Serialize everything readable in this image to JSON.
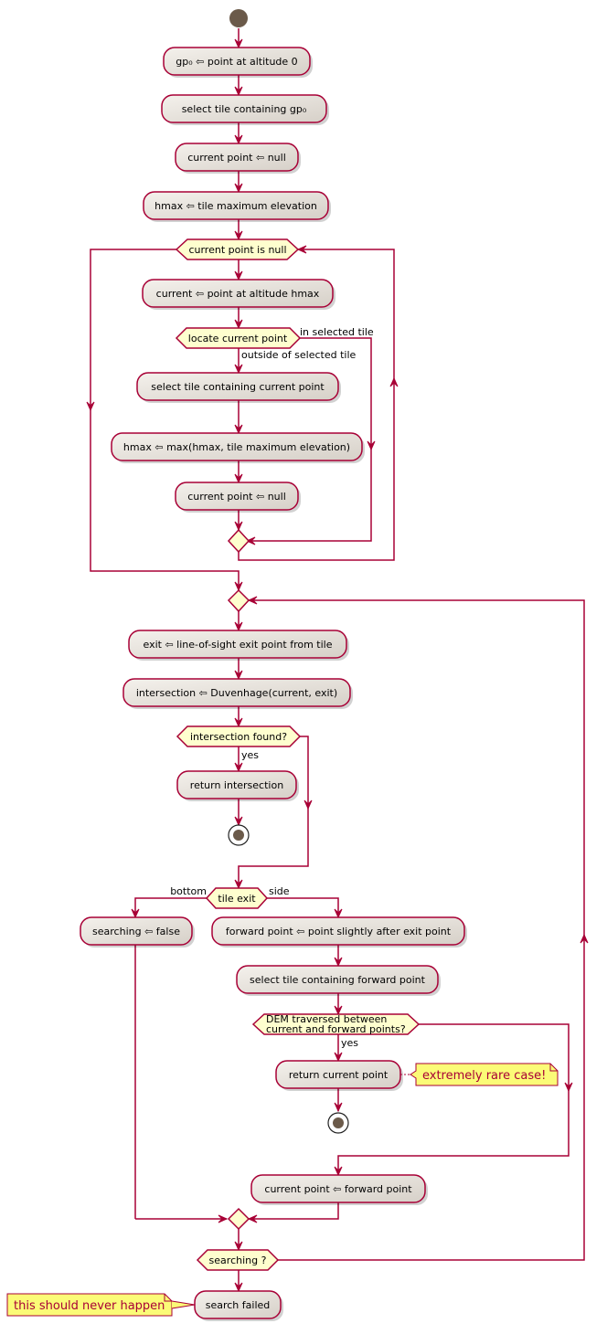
{
  "diagram": {
    "type": "activity",
    "colors": {
      "border": "#A80036",
      "activity_fill": "#FEFECE",
      "diamond_fill": "#FEFECE",
      "start_node": "#222222",
      "note_fill": "#FBFB77",
      "note_text": "#A80036"
    },
    "activities": {
      "a1": "gp₀ ⇦ point at altitude 0",
      "a2": "select tile containing gp₀",
      "a3": "current point ⇦ null",
      "a4": "hmax ⇦ tile maximum elevation",
      "a5": "current ⇦ point at altitude hmax",
      "a6": "select tile containing current point",
      "a7": "hmax ⇦ max(hmax, tile maximum elevation)",
      "a8": "current point ⇦ null",
      "a9": "exit ⇦ line-of-sight exit point from tile",
      "a10": "intersection ⇦ Duvenhage(current, exit)",
      "a11": "return intersection",
      "a12": "searching ⇦ false",
      "a13": "forward point ⇦ point slightly after exit point",
      "a14": "select tile containing forward point",
      "a15": "return current point",
      "a16": "current point ⇦ forward point",
      "a17": "search failed"
    },
    "decisions": {
      "d1": "current point is null",
      "d2": "locate current point",
      "d3": "intersection found?",
      "d4": "tile exit",
      "d5_line1": "DEM traversed between",
      "d5_line2": "current and forward points?",
      "d6": "searching ?"
    },
    "branch_labels": {
      "d2_right": "in selected tile",
      "d2_down": "outside of selected tile",
      "d3_down": "yes",
      "d4_left": "bottom",
      "d4_right": "side",
      "d5_down": "yes"
    },
    "notes": {
      "n1": "extremely rare case!",
      "n2": "this should never happen"
    }
  }
}
